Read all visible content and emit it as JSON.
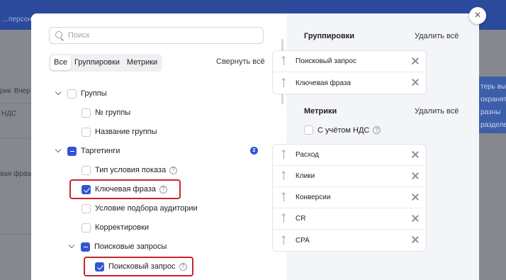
{
  "background": {
    "header_text": "…персональн",
    "left_texts": [
      "рик",
      "Вчер",
      "НДС",
      "вая фраза"
    ],
    "banner_lines": [
      "терь вы",
      "охранят",
      "разны",
      "разделе"
    ]
  },
  "search": {
    "placeholder": "Поиск"
  },
  "tabs": [
    {
      "label": "Все",
      "active": true
    },
    {
      "label": "Группировки",
      "active": false
    },
    {
      "label": "Метрики",
      "active": false
    }
  ],
  "collapse_all_label": "Свернуть всё",
  "tree": {
    "groups": {
      "label": "Группы",
      "checked": false
    },
    "group_number": {
      "label": "№ группы",
      "checked": false
    },
    "group_name": {
      "label": "Название группы",
      "checked": false
    },
    "targeting": {
      "label": "Таргетинги",
      "state": "partial",
      "badge": "2"
    },
    "display_condition": {
      "label": "Тип условия показа",
      "checked": false
    },
    "keyword": {
      "label": "Ключевая фраза",
      "checked": true
    },
    "audience_condition": {
      "label": "Условие подбора аудитории",
      "checked": false
    },
    "adjustments": {
      "label": "Корректировки",
      "checked": false
    },
    "search_queries": {
      "label": "Поисковые запросы",
      "state": "partial"
    },
    "search_query": {
      "label": "Поисковый запрос",
      "checked": true
    }
  },
  "right": {
    "groupings_title": "Группировки",
    "groupings_clear": "Удалить всё",
    "groupings": [
      "Поисковый запрос",
      "Ключевая фраза"
    ],
    "metrics_title": "Метрики",
    "metrics_clear": "Удалить всё",
    "vat_label": "С учётом НДС",
    "metrics": [
      "Расход",
      "Клики",
      "Конверсии",
      "CR",
      "CPA"
    ]
  },
  "colors": {
    "accent": "#2f55d4",
    "highlight": "#c9252b"
  }
}
